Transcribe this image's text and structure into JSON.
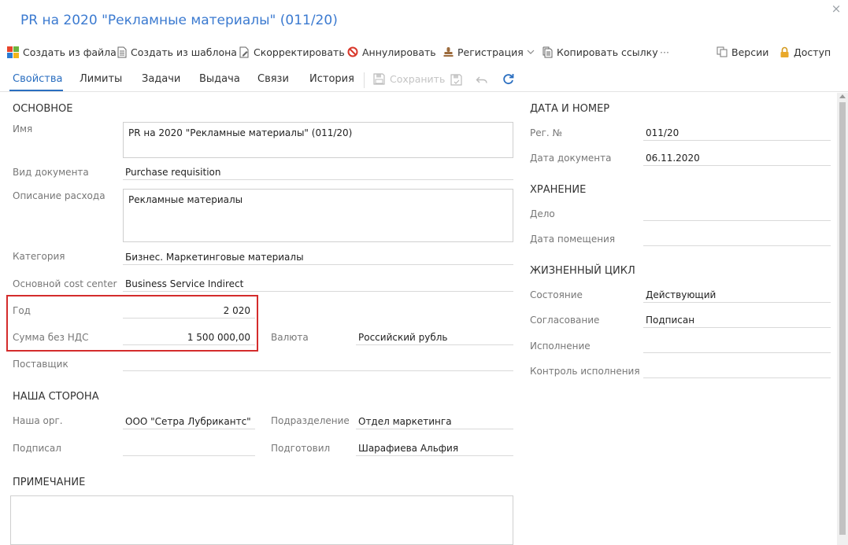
{
  "window": {
    "title": "PR на 2020 \"Рекламные материалы\" (011/20)",
    "close_glyph": "×"
  },
  "toolbar": {
    "create_from_file": "Создать из файла",
    "create_from_template": "Создать из шаблона",
    "correct": "Скорректировать",
    "annul": "Аннулировать",
    "registration": "Регистрация",
    "copy_link": "Копировать ссылку",
    "more": "···",
    "versions": "Версии",
    "access": "Доступ"
  },
  "tabs": {
    "properties": "Свойства",
    "limits": "Лимиты",
    "tasks": "Задачи",
    "issue": "Выдача",
    "links": "Связи",
    "history": "История",
    "save": "Сохранить"
  },
  "main": {
    "section_title": "ОСНОВНОЕ",
    "name_label": "Имя",
    "name_value": "PR на 2020 \"Рекламные материалы\" (011/20)",
    "doc_type_label": "Вид документа",
    "doc_type_value": "Purchase requisition",
    "expense_desc_label": "Описание расхода",
    "expense_desc_value": "Рекламные материалы",
    "category_label": "Категория",
    "category_value": "Бизнес. Маркетинговые материалы",
    "cost_center_label": "Основной cost center",
    "cost_center_value": "Business Service Indirect",
    "year_label": "Год",
    "year_value": "2 020",
    "amount_label": "Сумма без НДС",
    "amount_value": "1 500 000,00",
    "currency_label": "Валюта",
    "currency_value": "Российский рубль",
    "supplier_label": "Поставщик",
    "supplier_value": ""
  },
  "our_side": {
    "section_title": "НАША СТОРОНА",
    "org_label": "Наша орг.",
    "org_value": "ООО \"Сетра Лубрикантс\"",
    "department_label": "Подразделение",
    "department_value": "Отдел маркетинга",
    "signed_label": "Подписал",
    "signed_value": "",
    "prepared_label": "Подготовил",
    "prepared_value": "Шарафиева Альфия"
  },
  "note": {
    "section_title": "ПРИМЕЧАНИЕ",
    "value": ""
  },
  "date_number": {
    "section_title": "ДАТА И НОМЕР",
    "reg_label": "Рег. №",
    "reg_value": "011/20",
    "date_label": "Дата документа",
    "date_value": "06.11.2020"
  },
  "storage": {
    "section_title": "ХРАНЕНИЕ",
    "case_label": "Дело",
    "case_value": "",
    "placement_date_label": "Дата помещения",
    "placement_date_value": ""
  },
  "lifecycle": {
    "section_title": "ЖИЗНЕННЫЙ ЦИКЛ",
    "state_label": "Состояние",
    "state_value": "Действующий",
    "approval_label": "Согласование",
    "approval_value": "Подписан",
    "execution_label": "Исполнение",
    "execution_value": "",
    "control_label": "Контроль исполнения",
    "control_value": ""
  },
  "colors": {
    "accent": "#2a6ec0",
    "title": "#3b7ad0",
    "highlight": "#d42c2c"
  }
}
